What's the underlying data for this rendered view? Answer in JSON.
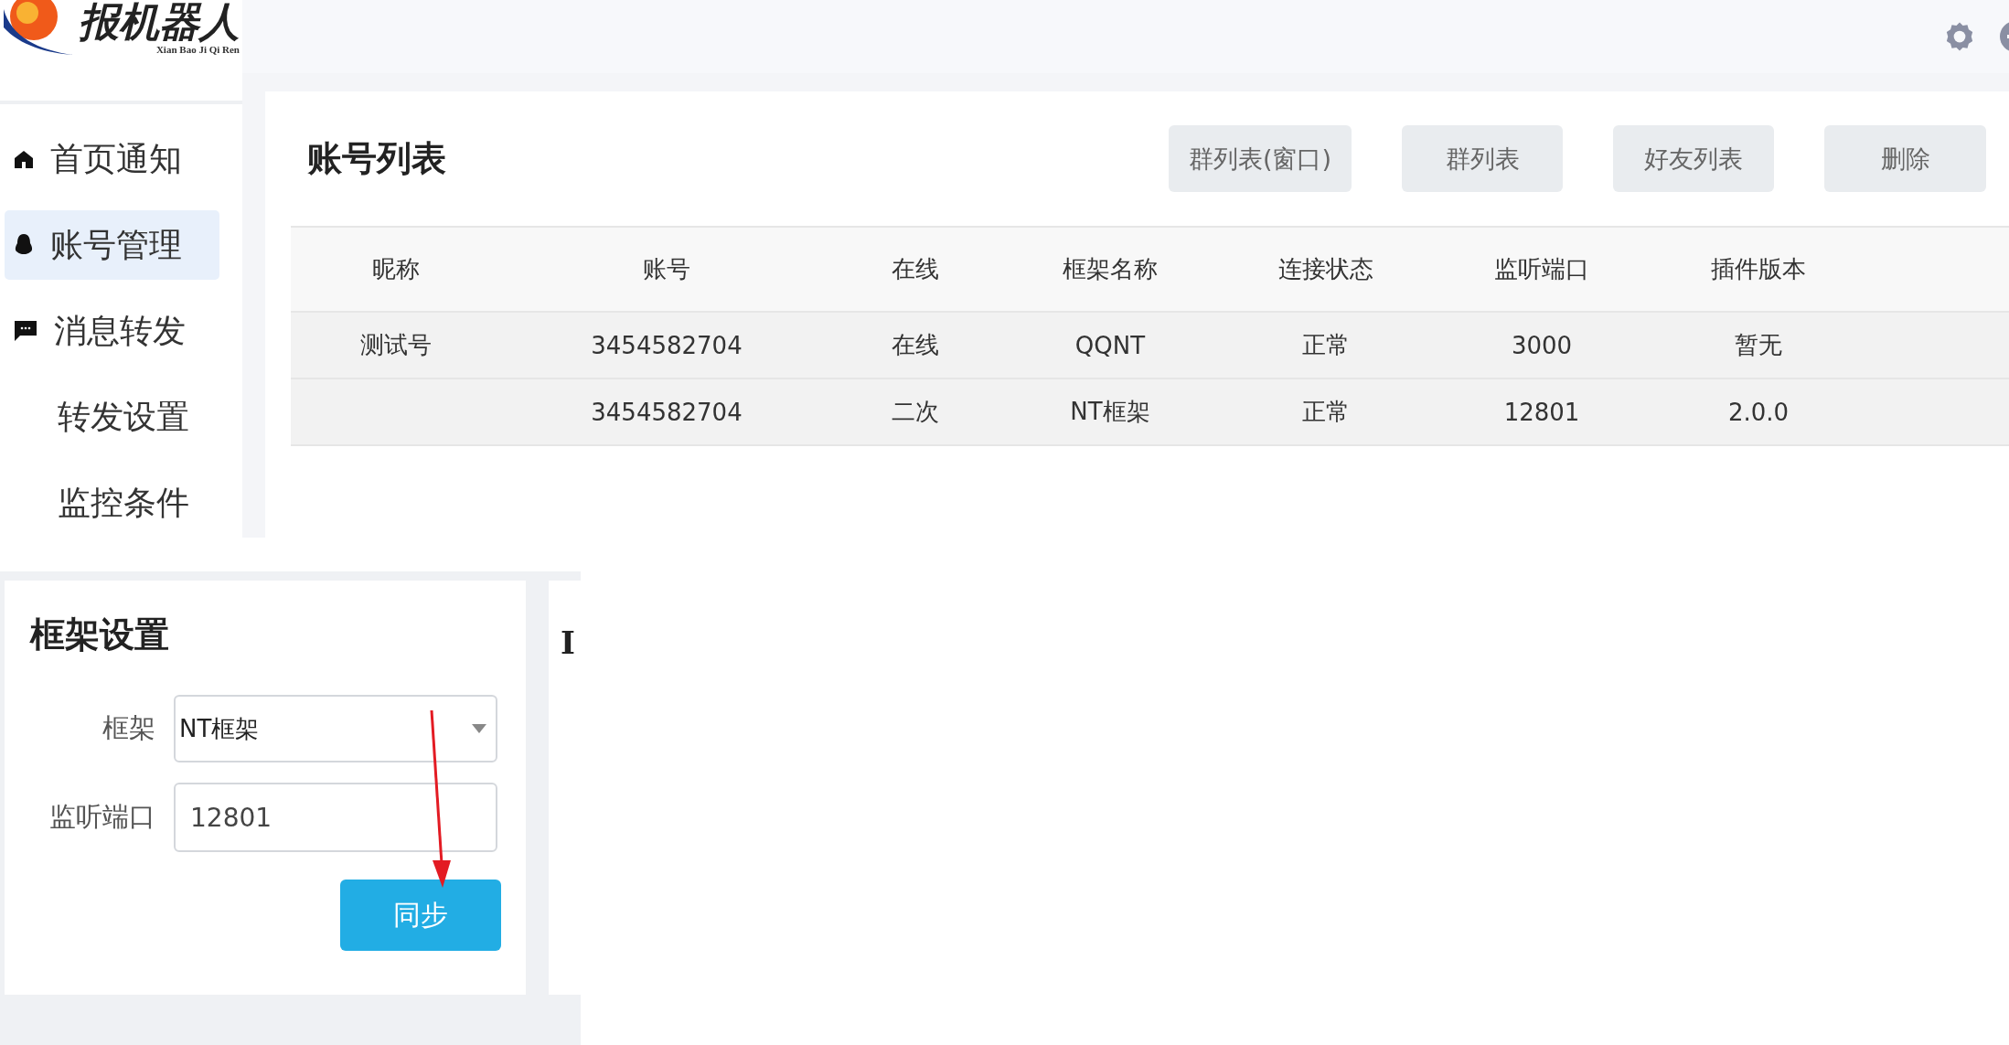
{
  "logo": {
    "title": "报机器人",
    "subtitle": "Xian Bao Ji Qi Ren"
  },
  "sidebar": {
    "items": [
      {
        "label": "首页通知",
        "kind": "home",
        "selected": false
      },
      {
        "label": "账号管理",
        "kind": "account",
        "selected": true
      },
      {
        "label": "消息转发",
        "kind": "message",
        "selected": false
      },
      {
        "label": "转发设置",
        "kind": "sub",
        "selected": false
      },
      {
        "label": "监控条件",
        "kind": "sub",
        "selected": false
      }
    ]
  },
  "account_list": {
    "title": "账号列表",
    "buttons": [
      "群列表(窗口)",
      "群列表",
      "好友列表",
      "删除"
    ],
    "table": {
      "columns": [
        "昵称",
        "账号",
        "在线",
        "框架名称",
        "连接状态",
        "监听端口",
        "插件版本"
      ],
      "rows": [
        [
          "测试号",
          "3454582704",
          "在线",
          "QQNT",
          "正常",
          "3000",
          "暂无"
        ],
        [
          "",
          "3454582704",
          "二次",
          "NT框架",
          "正常",
          "12801",
          "2.0.0"
        ]
      ]
    }
  },
  "framework_settings": {
    "title": "框架设置",
    "fields": [
      {
        "kind": "select",
        "label": "框架",
        "value": "NT框架"
      },
      {
        "kind": "input",
        "label": "监听端口",
        "value": "12801"
      }
    ],
    "button": "同步"
  },
  "next_card": {
    "title": "I"
  }
}
